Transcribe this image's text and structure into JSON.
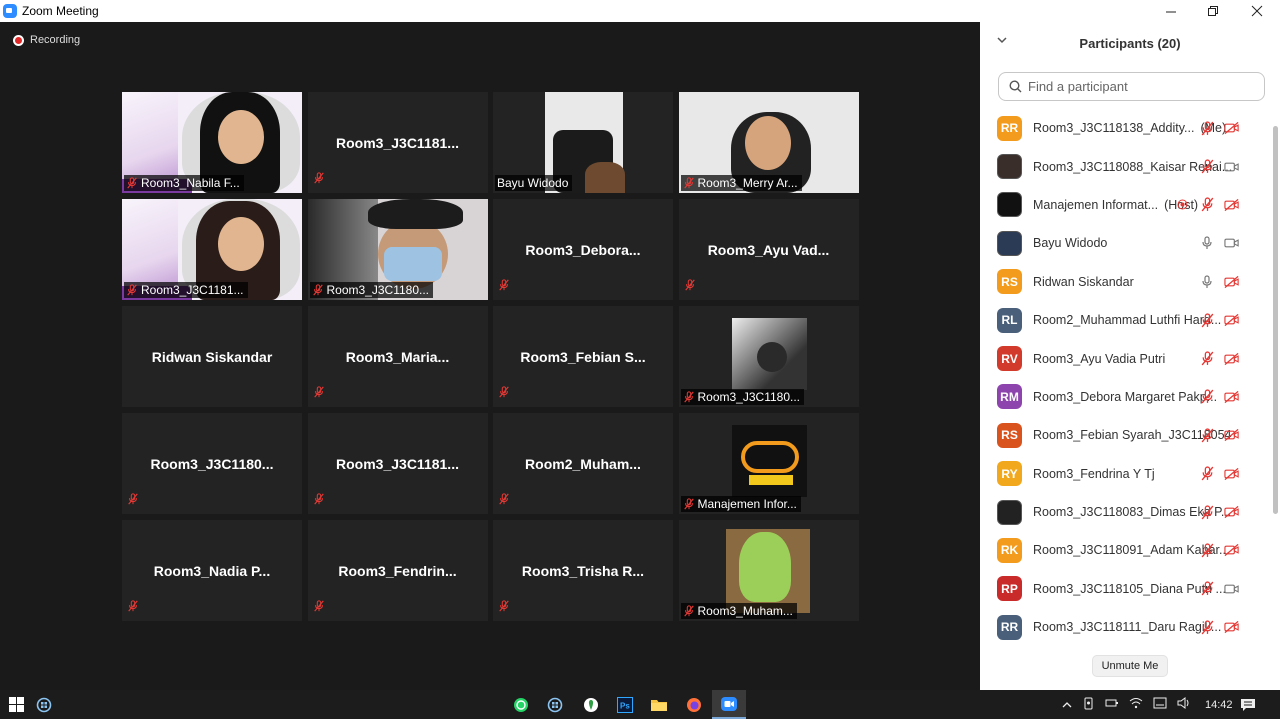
{
  "window": {
    "title": "Zoom Meeting",
    "controls": [
      "minimize",
      "restore",
      "close"
    ]
  },
  "recording": {
    "label": "Recording"
  },
  "tiles": [
    {
      "label": "Room3_Nabila F...",
      "video": "slide",
      "muted": true
    },
    {
      "label": "Room3_J3C1181...",
      "video": "none",
      "muted": true
    },
    {
      "label": "Bayu Widodo",
      "video": "camera",
      "muted": false,
      "active_speaker": true
    },
    {
      "label": "Room3_Merry Ar...",
      "video": "camera",
      "muted": true
    },
    {
      "label": "Room3_J3C1181...",
      "video": "slide",
      "muted": true
    },
    {
      "label": "Room3_J3C1180...",
      "video": "camera",
      "muted": true
    },
    {
      "label": "Room3_Debora...",
      "video": "none",
      "muted": true
    },
    {
      "label": "Room3_Ayu Vad...",
      "video": "none",
      "muted": true
    },
    {
      "label": "Ridwan Siskandar",
      "video": "none",
      "muted": false
    },
    {
      "label": "Room3_Maria...",
      "video": "none",
      "muted": true
    },
    {
      "label": "Room3_Febian S...",
      "video": "none",
      "muted": true
    },
    {
      "label": "Room3_J3C1180...",
      "video": "avatar-photo",
      "muted": true
    },
    {
      "label": "Room3_J3C1180...",
      "video": "none",
      "muted": true
    },
    {
      "label": "Room3_J3C1181...",
      "video": "none",
      "muted": true
    },
    {
      "label": "Room2_Muham...",
      "video": "none",
      "muted": true
    },
    {
      "label": "Manajemen Infor...",
      "video": "avatar-logo",
      "muted": true
    },
    {
      "label": "Room3_Nadia P...",
      "video": "none",
      "muted": true
    },
    {
      "label": "Room3_Fendrin...",
      "video": "none",
      "muted": true
    },
    {
      "label": "Room3_Trisha R...",
      "video": "none",
      "muted": true
    },
    {
      "label": "Room3_Muham...",
      "video": "avatar-photo2",
      "muted": true
    }
  ],
  "participants_panel": {
    "title": "Participants (20)",
    "search_placeholder": "Find a participant",
    "unmute_label": "Unmute Me",
    "participants": [
      {
        "initials": "RR",
        "color": "#f29b1c",
        "name": "Room3_J3C118138_Addity...",
        "tag": "(Me)",
        "mic": "muted",
        "video": "off"
      },
      {
        "initials": "",
        "color": "#3a2e2a",
        "name": "Room3_J3C118088_Kaisar Renai...",
        "tag": "",
        "mic": "muted",
        "video": "on"
      },
      {
        "initials": "",
        "color": "#111111",
        "name": "Manajemen Informat...",
        "tag": "(Host)",
        "mic": "muted",
        "video": "off",
        "recording": true
      },
      {
        "initials": "",
        "color": "#2b3a55",
        "name": "Bayu Widodo",
        "tag": "",
        "mic": "on",
        "video": "on"
      },
      {
        "initials": "RS",
        "color": "#f29b1c",
        "name": "Ridwan Siskandar",
        "tag": "",
        "mic": "on",
        "video": "off"
      },
      {
        "initials": "RL",
        "color": "#4a5f7a",
        "name": "Room2_Muhammad Luthfi Hard...",
        "tag": "",
        "mic": "muted",
        "video": "off"
      },
      {
        "initials": "RV",
        "color": "#d23b2b",
        "name": "Room3_Ayu Vadia Putri",
        "tag": "",
        "mic": "muted",
        "video": "off"
      },
      {
        "initials": "RM",
        "color": "#8e44ad",
        "name": "Room3_Debora Margaret Pakp...",
        "tag": "",
        "mic": "muted",
        "video": "off"
      },
      {
        "initials": "RS",
        "color": "#d9531e",
        "name": "Room3_Febian Syarah_J3C118054",
        "tag": "",
        "mic": "muted",
        "video": "off"
      },
      {
        "initials": "RY",
        "color": "#f2a81c",
        "name": "Room3_Fendrina Y Tj",
        "tag": "",
        "mic": "muted",
        "video": "off"
      },
      {
        "initials": "",
        "color": "#222222",
        "name": "Room3_J3C118083_Dimas Eka P...",
        "tag": "",
        "mic": "muted",
        "video": "off"
      },
      {
        "initials": "RK",
        "color": "#f29b1c",
        "name": "Room3_J3C118091_Adam Kahar...",
        "tag": "",
        "mic": "muted",
        "video": "off"
      },
      {
        "initials": "RP",
        "color": "#c92a2a",
        "name": "Room3_J3C118105_Diana Putri ...",
        "tag": "",
        "mic": "muted",
        "video": "on"
      },
      {
        "initials": "RR",
        "color": "#4a5f7a",
        "name": "Room3_J3C118111_Daru Ragil ...",
        "tag": "",
        "mic": "muted",
        "video": "off"
      }
    ]
  },
  "taskbar": {
    "apps": [
      "start",
      "task-view",
      "whatsapp",
      "task-view-2",
      "maps",
      "photoshop",
      "file-explorer",
      "firefox",
      "zoom"
    ],
    "clock": "14:42"
  }
}
